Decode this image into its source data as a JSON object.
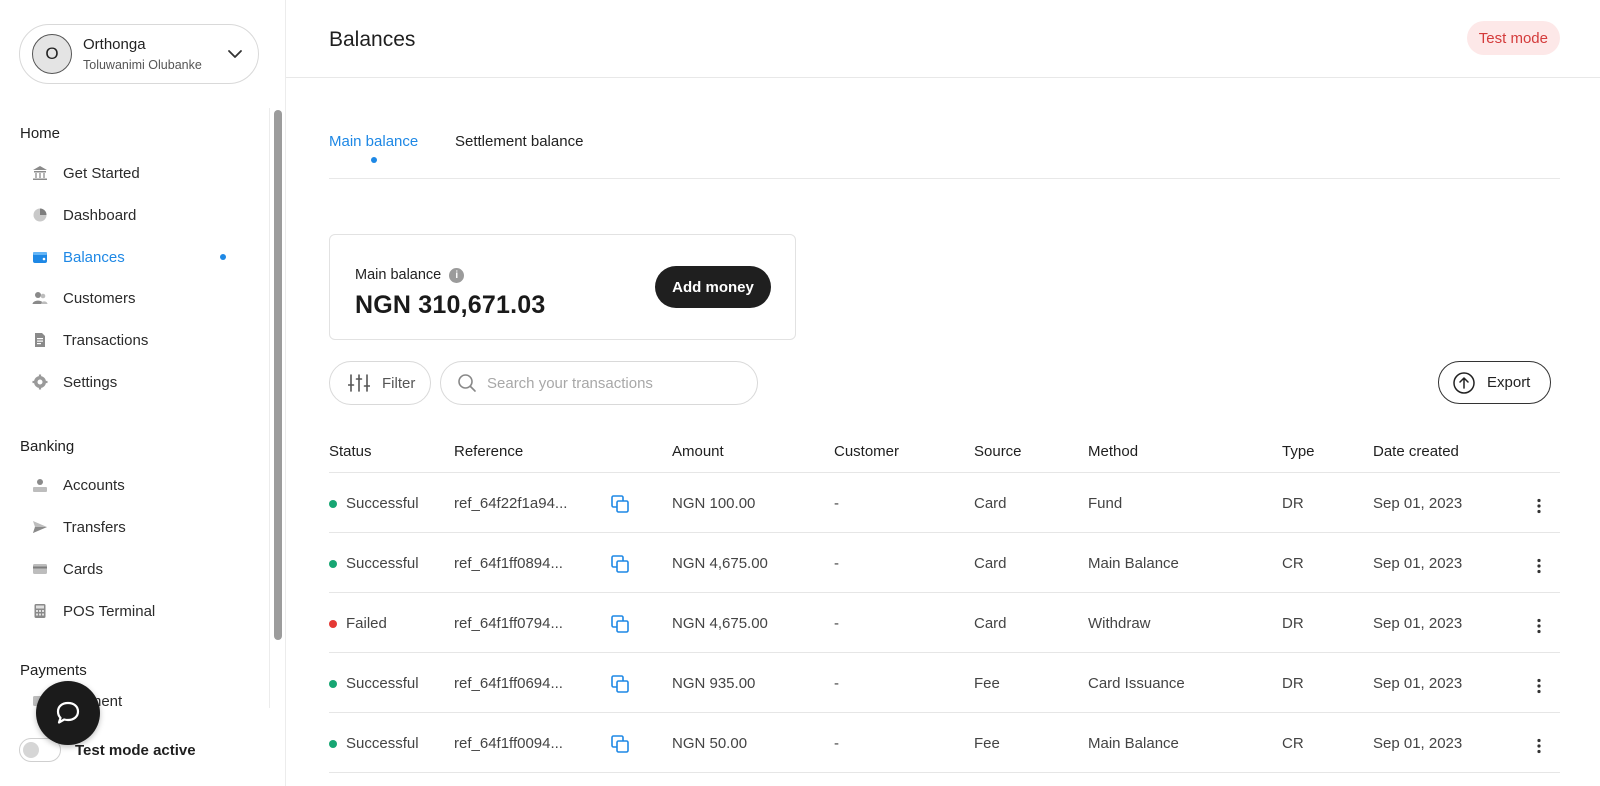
{
  "account": {
    "initial": "O",
    "name": "Orthonga",
    "user": "Toluwanimi Olubanke"
  },
  "sidebar": {
    "sections": {
      "home": "Home",
      "banking": "Banking",
      "payments": "Payments"
    },
    "home_items": [
      {
        "label": "Get Started",
        "icon": "bank-icon"
      },
      {
        "label": "Dashboard",
        "icon": "pie-chart-icon"
      },
      {
        "label": "Balances",
        "icon": "wallet-icon",
        "active": true
      },
      {
        "label": "Customers",
        "icon": "users-icon"
      },
      {
        "label": "Transactions",
        "icon": "document-icon"
      },
      {
        "label": "Settings",
        "icon": "gear-icon"
      }
    ],
    "banking_items": [
      {
        "label": "Accounts",
        "icon": "account-icon"
      },
      {
        "label": "Transfers",
        "icon": "send-icon"
      },
      {
        "label": "Cards",
        "icon": "card-icon"
      },
      {
        "label": "POS Terminal",
        "icon": "calculator-icon"
      }
    ],
    "payments_items": [
      {
        "label": "Payment",
        "icon": "payment-icon"
      }
    ],
    "test_mode_label": "Test mode active"
  },
  "header": {
    "title": "Balances",
    "badge": "Test mode"
  },
  "tabs": [
    {
      "label": "Main balance",
      "active": true
    },
    {
      "label": "Settlement balance"
    }
  ],
  "balance": {
    "label": "Main balance",
    "amount": "NGN 310,671.03",
    "add_money": "Add money"
  },
  "toolbar": {
    "filter": "Filter",
    "search_placeholder": "Search your transactions",
    "export": "Export"
  },
  "table": {
    "columns": [
      "Status",
      "Reference",
      "Amount",
      "Customer",
      "Source",
      "Method",
      "Type",
      "Date created"
    ],
    "rows": [
      {
        "status": "Successful",
        "reference": "ref_64f22f1a94...",
        "amount": "NGN 100.00",
        "customer": "-",
        "source": "Card",
        "method": "Fund",
        "type": "DR",
        "date": "Sep 01, 2023"
      },
      {
        "status": "Successful",
        "reference": "ref_64f1ff0894...",
        "amount": "NGN 4,675.00",
        "customer": "-",
        "source": "Card",
        "method": "Main Balance",
        "type": "CR",
        "date": "Sep 01, 2023"
      },
      {
        "status": "Failed",
        "reference": "ref_64f1ff0794...",
        "amount": "NGN 4,675.00",
        "customer": "-",
        "source": "Card",
        "method": "Withdraw",
        "type": "DR",
        "date": "Sep 01, 2023"
      },
      {
        "status": "Successful",
        "reference": "ref_64f1ff0694...",
        "amount": "NGN 935.00",
        "customer": "-",
        "source": "Fee",
        "method": "Card Issuance",
        "type": "DR",
        "date": "Sep 01, 2023"
      },
      {
        "status": "Successful",
        "reference": "ref_64f1ff0094...",
        "amount": "NGN 50.00",
        "customer": "-",
        "source": "Fee",
        "method": "Main Balance",
        "type": "CR",
        "date": "Sep 01, 2023"
      }
    ]
  },
  "colors": {
    "accent": "#1e88e5",
    "success": "#17a673",
    "failed": "#e53935",
    "badge_bg": "#fde8e8",
    "badge_text": "#d43b3b"
  }
}
